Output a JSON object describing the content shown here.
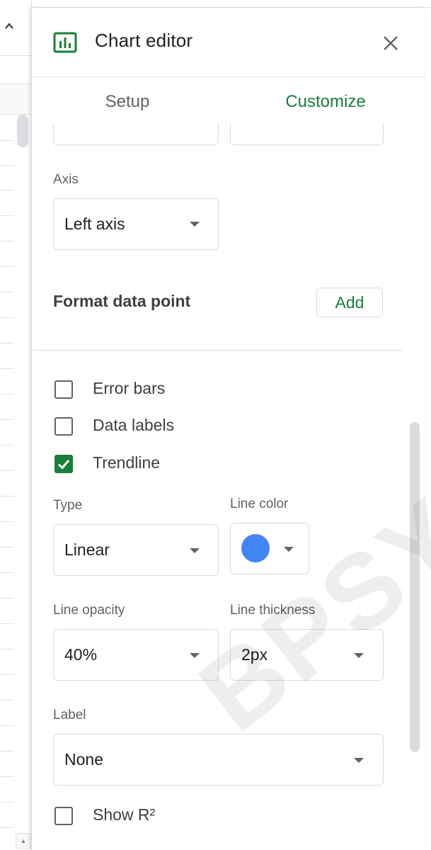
{
  "panel": {
    "title": "Chart editor",
    "close_icon": "close-icon",
    "chart_icon": "bar-chart-icon"
  },
  "tabs": [
    {
      "label": "Setup",
      "active": false
    },
    {
      "label": "Customize",
      "active": true
    }
  ],
  "axis": {
    "label": "Axis",
    "value": "Left axis"
  },
  "format_data_point": {
    "label": "Format data point",
    "button": "Add"
  },
  "checkboxes": [
    {
      "label": "Error bars",
      "checked": false
    },
    {
      "label": "Data labels",
      "checked": false
    },
    {
      "label": "Trendline",
      "checked": true
    }
  ],
  "trendline": {
    "type_label": "Type",
    "type_value": "Linear",
    "line_color_label": "Line color",
    "line_color": "#4285f4",
    "opacity_label": "Line opacity",
    "opacity_value": "40%",
    "thickness_label": "Line thickness",
    "thickness_value": "2px",
    "label_label": "Label",
    "label_value": "None",
    "show_r2": {
      "label": "Show R²",
      "checked": false
    }
  },
  "watermark": "BPSYCH",
  "colors": {
    "accent_green": "#188038",
    "text_gray": "#5f6368",
    "border": "#dadce0"
  }
}
